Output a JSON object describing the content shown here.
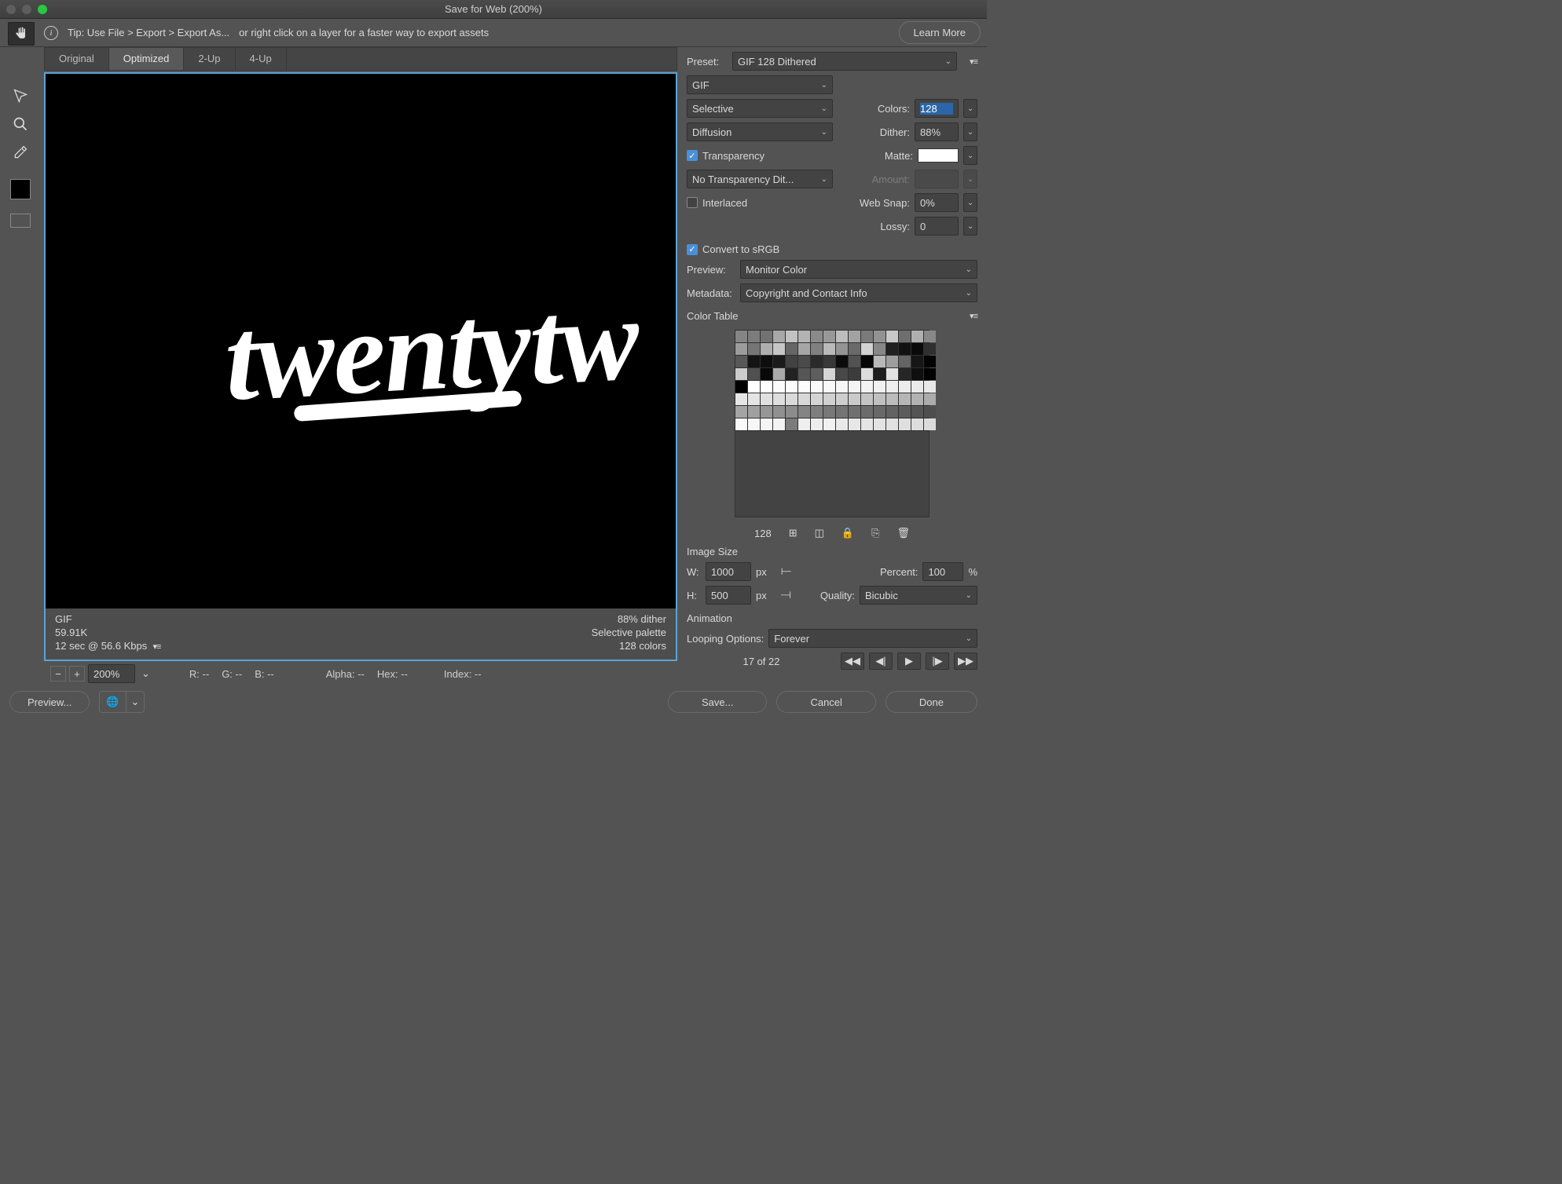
{
  "window": {
    "title": "Save for Web (200%)"
  },
  "tip": {
    "text_a": "Tip: Use File > Export > Export As...",
    "text_b": "or right click on a layer for a faster way to export assets",
    "learn_more": "Learn More"
  },
  "tabs": {
    "original": "Original",
    "optimized": "Optimized",
    "two_up": "2-Up",
    "four_up": "4-Up"
  },
  "canvas": {
    "logo_text": "twentytw"
  },
  "info": {
    "format": "GIF",
    "filesize": "59.91K",
    "loadtime": "12 sec @ 56.6 Kbps",
    "dither_line": "88% dither",
    "palette_line": "Selective palette",
    "colors_line": "128 colors"
  },
  "status": {
    "zoom": "200%",
    "r": "R: --",
    "g": "G: --",
    "b": "B: --",
    "alpha": "Alpha: --",
    "hex": "Hex: --",
    "index": "Index: --"
  },
  "right": {
    "preset_label": "Preset:",
    "preset_value": "GIF 128 Dithered",
    "format": "GIF",
    "reduction": "Selective",
    "colors_label": "Colors:",
    "colors_value": "128",
    "dither_method": "Diffusion",
    "dither_label": "Dither:",
    "dither_value": "88%",
    "transparency_chk": "Transparency",
    "matte_label": "Matte:",
    "trans_dither": "No Transparency Dit...",
    "amount_label": "Amount:",
    "interlaced_chk": "Interlaced",
    "websnap_label": "Web Snap:",
    "websnap_value": "0%",
    "lossy_label": "Lossy:",
    "lossy_value": "0",
    "convert_srgb": "Convert to sRGB",
    "preview_label": "Preview:",
    "preview_value": "Monitor Color",
    "metadata_label": "Metadata:",
    "metadata_value": "Copyright and Contact Info",
    "color_table_label": "Color Table",
    "color_count": "128",
    "image_size_label": "Image Size",
    "w_label": "W:",
    "w_value": "1000",
    "px": "px",
    "h_label": "H:",
    "h_value": "500",
    "percent_label": "Percent:",
    "percent_value": "100",
    "percent_unit": "%",
    "quality_label": "Quality:",
    "quality_value": "Bicubic",
    "animation_label": "Animation",
    "looping_label": "Looping Options:",
    "looping_value": "Forever",
    "frame_of": "17 of 22"
  },
  "bottom": {
    "preview": "Preview...",
    "save": "Save...",
    "cancel": "Cancel",
    "done": "Done"
  },
  "color_table": [
    "#858585",
    "#7c7c7c",
    "#727272",
    "#a8a8a8",
    "#c2c2c2",
    "#b3b3b3",
    "#8a8a8a",
    "#989898",
    "#bdbdbd",
    "#a2a2a2",
    "#7a7a7a",
    "#929292",
    "#c8c8c8",
    "#6e6e6e",
    "#b0b0b0",
    "#888888",
    "#9c9c9c",
    "#767676",
    "#aeaeae",
    "#c6c6c6",
    "#666666",
    "#a6a6a6",
    "#808080",
    "#bababa",
    "#949494",
    "#6a6a6a",
    "#d2d2d2",
    "#878787",
    "#202020",
    "#121212",
    "#0a0a0a",
    "#303030",
    "#585858",
    "#141414",
    "#0e0e0e",
    "#1a1a1a",
    "#424242",
    "#4a4a4a",
    "#2a2a2a",
    "#383838",
    "#0c0c0c",
    "#525252",
    "#060606",
    "#b8b8b8",
    "#9e9e9e",
    "#646464",
    "#161616",
    "#040404",
    "#cccccc",
    "#505050",
    "#080808",
    "#aaa9a9",
    "#222222",
    "#565656",
    "#5e5e5e",
    "#d6d6d6",
    "#484848",
    "#3c3c3c",
    "#dcdcdc",
    "#1e1e1e",
    "#e2e2e2",
    "#262626",
    "#0f0f0f",
    "#020202",
    "#000000",
    "#ffffff",
    "#fefefe",
    "#fdfdfd",
    "#fcfcfc",
    "#fbfbfb",
    "#fafafa",
    "#f8f8f8",
    "#f6f6f6",
    "#f4f4f4",
    "#f2f2f2",
    "#f0f0f0",
    "#eeeeee",
    "#ececec",
    "#eaeaea",
    "#e8e8e8",
    "#e6e6e6",
    "#e4e4e4",
    "#e0e0e0",
    "#dedede",
    "#dadada",
    "#d8d8d8",
    "#d4d4d4",
    "#d0d0d0",
    "#cecece",
    "#cacaca",
    "#c4c4c4",
    "#c0c0c0",
    "#bcbcbc",
    "#b6b6b6",
    "#b2b2b2",
    "#acacac",
    "#a4a4a4",
    "#a0a0a0",
    "#969696",
    "#909090",
    "#8c8c8c",
    "#848484",
    "#7e7e7e",
    "#787878",
    "#747474",
    "#707070",
    "#6c6c6c",
    "#686868",
    "#626262",
    "#5c5c5c",
    "#545454",
    "#4e4e4e",
    "#f9f9f9",
    "#f7f7f7",
    "#f5f5f5",
    "#f3f3f3",
    "#7b7b7b",
    "#efefef",
    "#ededed",
    "#f1f1f1",
    "#e9e9e9",
    "#e7e7e7",
    "#e5e5e5",
    "#e3e3e3",
    "#e1e1e1",
    "#dfdfdf",
    "#dddddd",
    "#dbdbdb"
  ]
}
